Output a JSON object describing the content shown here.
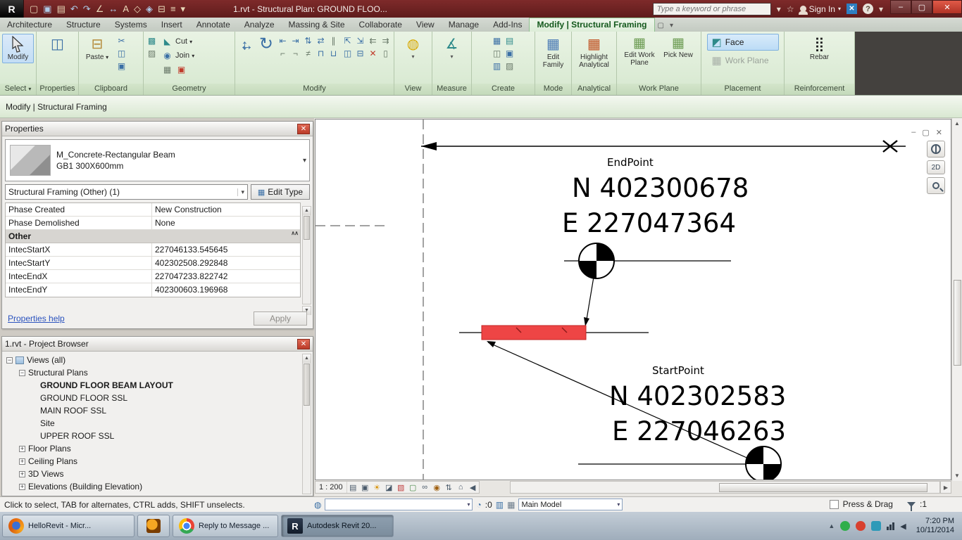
{
  "title_bar": {
    "app_initial": "R",
    "title": "1.rvt - Structural Plan: GROUND FLOO...",
    "search_placeholder": "Type a keyword or phrase",
    "sign_in": "Sign In"
  },
  "ribbon": {
    "tabs": [
      "Architecture",
      "Structure",
      "Systems",
      "Insert",
      "Annotate",
      "Analyze",
      "Massing & Site",
      "Collaborate",
      "View",
      "Manage",
      "Add-Ins",
      "Modify | Structural Framing"
    ],
    "panels": [
      {
        "label": "Select",
        "buttons": [
          "Modify"
        ]
      },
      {
        "label": "Properties",
        "buttons": []
      },
      {
        "label": "Clipboard",
        "buttons": [
          "Paste"
        ]
      },
      {
        "label": "Geometry",
        "buttons": [
          "Cut",
          "Join"
        ]
      },
      {
        "label": "Modify",
        "buttons": []
      },
      {
        "label": "View",
        "buttons": []
      },
      {
        "label": "Measure",
        "buttons": []
      },
      {
        "label": "Create",
        "buttons": []
      },
      {
        "label": "Mode",
        "buttons": [
          "Edit Family"
        ]
      },
      {
        "label": "Analytical",
        "buttons": [
          "Highlight Analytical"
        ]
      },
      {
        "label": "Work Plane",
        "buttons": [
          "Edit Work Plane",
          "Pick New"
        ]
      },
      {
        "label": "Placement",
        "buttons": [
          "Face",
          "Work Plane"
        ]
      },
      {
        "label": "Reinforcement",
        "buttons": [
          "Rebar"
        ]
      }
    ]
  },
  "mode_bar": {
    "label": "Modify | Structural Framing"
  },
  "properties": {
    "title": "Properties",
    "type_name": "M_Concrete-Rectangular Beam",
    "type_variant": "GB1 300X600mm",
    "selector": "Structural Framing (Other) (1)",
    "edit_type_label": "Edit Type",
    "rows": [
      {
        "name": "Phase Created",
        "value": "New Construction"
      },
      {
        "name": "Phase Demolished",
        "value": "None"
      }
    ],
    "group_label": "Other",
    "coord_rows": [
      {
        "name": "IntecStartX",
        "value": "227046133.545645"
      },
      {
        "name": "IntecStartY",
        "value": "402302508.292848"
      },
      {
        "name": "IntecEndX",
        "value": "227047233.822742"
      },
      {
        "name": "IntecEndY",
        "value": "402300603.196968"
      }
    ],
    "help_link": "Properties help",
    "apply_label": "Apply"
  },
  "project_browser": {
    "title": "1.rvt - Project Browser",
    "items": [
      {
        "label": "Views (all)"
      },
      {
        "label": "Structural Plans"
      },
      {
        "label": "GROUND FLOOR BEAM LAYOUT"
      },
      {
        "label": "GROUND FLOOR SSL"
      },
      {
        "label": "MAIN ROOF SSL"
      },
      {
        "label": "Site"
      },
      {
        "label": "UPPER ROOF SSL"
      },
      {
        "label": "Floor Plans"
      },
      {
        "label": "Ceiling Plans"
      },
      {
        "label": "3D Views"
      },
      {
        "label": "Elevations (Building Elevation)"
      }
    ]
  },
  "drawing": {
    "endpoint": {
      "label": "EndPoint",
      "n": "N 402300678",
      "e": "E 227047364"
    },
    "startpoint": {
      "label": "StartPoint",
      "n": "N 402302583",
      "e": "E 227046263"
    },
    "nav_2d": "2D"
  },
  "view_bar": {
    "scale": "1 : 200"
  },
  "status_bar": {
    "message": "Click to select, TAB for alternates, CTRL adds, SHIFT unselects.",
    "editable_count": ":0",
    "design_option": "Main Model",
    "press_drag": "Press & Drag",
    "selection_count": ":1"
  },
  "taskbar": {
    "app1": "HelloRevit - Micr...",
    "app3": "Reply to Message ...",
    "app4": "Autodesk Revit 20...",
    "time": "7:20 PM",
    "date": "10/11/2014"
  },
  "icons": {
    "open": "▢",
    "save": "▣",
    "print": "▤",
    "undo": "↶",
    "redo": "↷",
    "measure": "∠",
    "dimension": "↔",
    "text_tool": "A",
    "tag": "◇",
    "view3d": "◈",
    "section": "⊟",
    "sun": "☀",
    "thin_lines": "≡",
    "dropdown": "▾",
    "close": "✕",
    "minimize": "–",
    "maximize": "▢",
    "help": "?",
    "star": "☆",
    "scissors": "✂",
    "copy": "◫",
    "match": "▣",
    "glue": "▩",
    "demolish": "▨",
    "cut": "◣",
    "join": "◉",
    "rotate": "↻",
    "bulb": "◍",
    "angle": "∡",
    "grid": "▦",
    "face": "◩",
    "rebar": "⣿",
    "expand": "+",
    "collapse": "−",
    "up": "▲",
    "down": "▼",
    "left": "◀",
    "right": "▶",
    "group_collapse": "∧∧",
    "detail": "▤",
    "style": "▣",
    "shadows": "◪",
    "crop": "▧",
    "crop_region": "▢",
    "glasses": "∞",
    "reveal": "◉",
    "worksharing": "⇅",
    "home": "⌂",
    "worksets": "◍",
    "editable": "◔",
    "options": "▥",
    "modify_small1": [
      "⇤",
      "⇥",
      "⇅",
      "⇄",
      "∥",
      "⌐",
      "¬",
      "≠",
      "⊓",
      "⊔"
    ],
    "modify_small2": [
      "⇱",
      "⇲",
      "⇇",
      "⇉",
      "◫",
      "⊟",
      "▭",
      "▯"
    ],
    "create_small": [
      "▦",
      "▤",
      "◫",
      "▣",
      "▥",
      "▨"
    ],
    "clipboard_small": [
      "✂",
      "◫",
      "▣"
    ]
  }
}
